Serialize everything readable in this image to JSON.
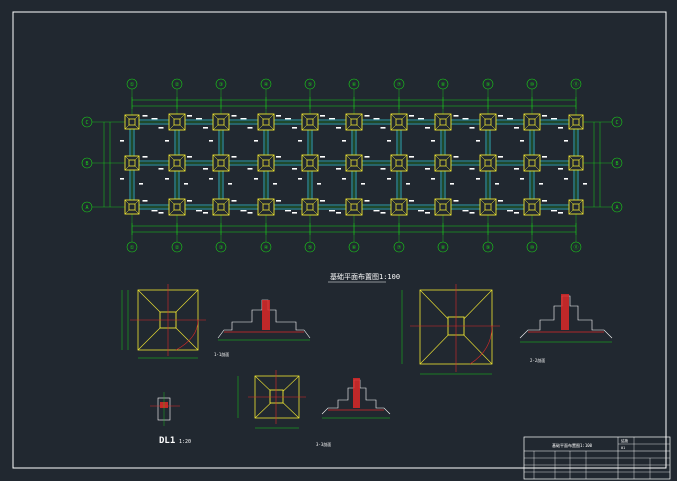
{
  "drawing": {
    "plan_title": "基础平面布置图1:100",
    "detail_label": "DL1",
    "detail_scale": "1:20",
    "section_label_1": "1-1剖面",
    "section_label_2": "2-2剖面",
    "section_label_3": "3-3剖面",
    "top_axis_labels": [
      "①",
      "②",
      "③",
      "④",
      "⑤",
      "⑥",
      "⑦",
      "⑧",
      "⑨",
      "⑩",
      "⑪"
    ],
    "bottom_axis_labels": [
      "①",
      "②",
      "③",
      "④",
      "⑤",
      "⑥",
      "⑦",
      "⑧",
      "⑨",
      "⑩",
      "⑪"
    ],
    "left_axis_labels": [
      "C",
      "B",
      "A"
    ],
    "right_axis_labels": [
      "C",
      "B",
      "A"
    ]
  },
  "title_block": {
    "drawing_name": "基础平面布置图1:100",
    "sheet_label": "结施",
    "sheet_no": "01"
  },
  "colors": {
    "background": "#212830",
    "axis_green": "#19d119",
    "beam_cyan": "#32c8d2",
    "footing_yellow": "#f0e632",
    "column_red": "#dc2828",
    "text_white": "#ffffff",
    "frame_white": "#ffffff"
  }
}
